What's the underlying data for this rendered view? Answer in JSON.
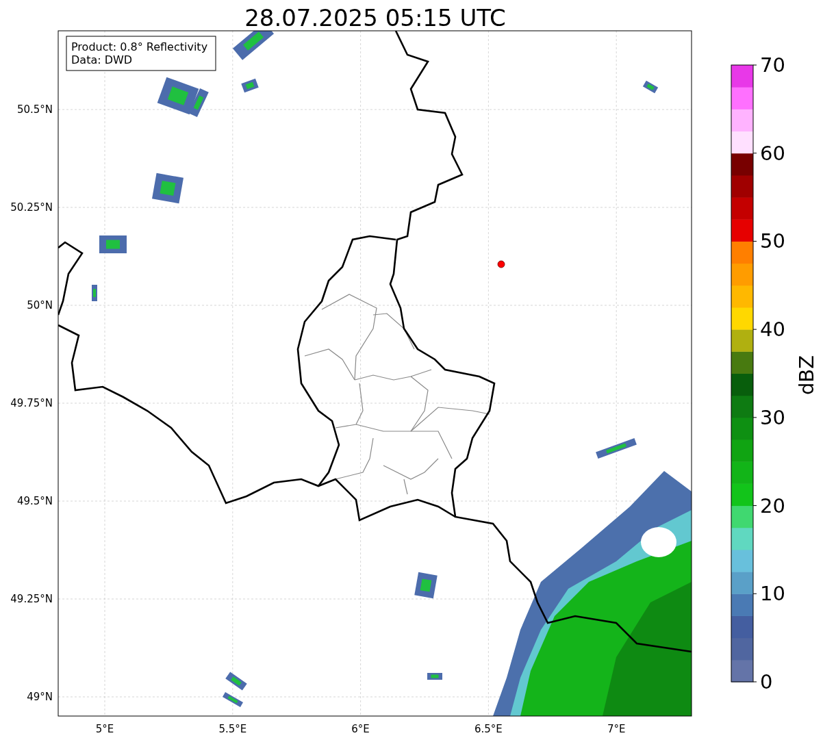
{
  "title": "28.07.2025 05:15 UTC",
  "info_box": {
    "lines": [
      "Product: 0.8° Reflectivity",
      "Data: DWD"
    ]
  },
  "x_ticks": [
    "5°E",
    "5.5°E",
    "6°E",
    "6.5°E",
    "7°E"
  ],
  "y_ticks": [
    "50.5°N",
    "50.25°N",
    "50°N",
    "49.75°N",
    "49.5°N",
    "49.25°N",
    "49°N"
  ],
  "colorbar": {
    "label": "dBZ",
    "ticks": [
      "70",
      "60",
      "50",
      "40",
      "30",
      "20",
      "10",
      "0"
    ]
  }
}
